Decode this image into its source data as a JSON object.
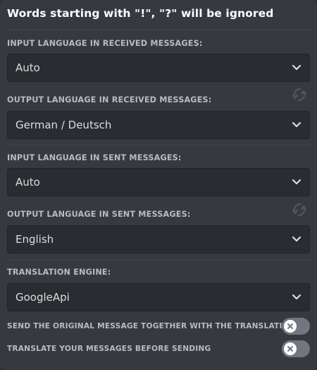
{
  "header": {
    "title": "Words starting with \"!\", \"?\" will be ignored"
  },
  "fields": [
    {
      "label": "INPUT LANGUAGE IN RECEIVED MESSAGES:",
      "value": "Auto"
    },
    {
      "label": "OUTPUT LANGUAGE IN RECEIVED MESSAGES:",
      "value": "German / Deutsch"
    },
    {
      "label": "INPUT LANGUAGE IN SENT MESSAGES:",
      "value": "Auto"
    },
    {
      "label": "OUTPUT LANGUAGE IN SENT MESSAGES:",
      "value": "English"
    },
    {
      "label": "TRANSLATION ENGINE:",
      "value": "GoogleApi"
    }
  ],
  "toggles": [
    {
      "label": "SEND THE ORIGINAL MESSAGE TOGETHER WITH THE TRANSLATION",
      "enabled": false
    },
    {
      "label": "TRANSLATE YOUR MESSAGES BEFORE SENDING",
      "enabled": false
    }
  ],
  "icons": {
    "swap": "swap-arrows-icon",
    "dropdown": "chevron-down-icon",
    "toggle_off": "close-icon"
  },
  "colors": {
    "background": "#36393f",
    "select_bg": "#2a2c31",
    "label": "#b9bbbe",
    "toggle_off": "#72767d"
  }
}
